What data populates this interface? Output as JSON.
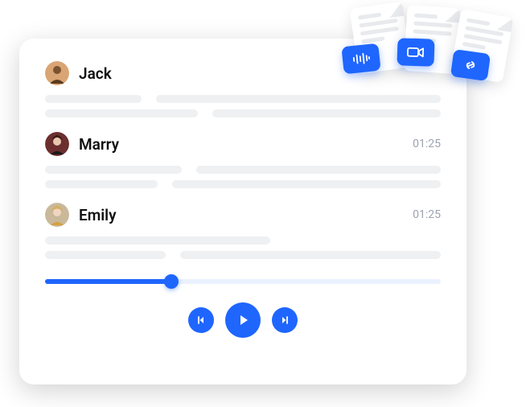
{
  "entries": [
    {
      "name": "Jack",
      "timestamp": "",
      "avatar_bg": "#d9a574"
    },
    {
      "name": "Marry",
      "timestamp": "01:25",
      "avatar_bg": "#6b2f2f"
    },
    {
      "name": "Emily",
      "timestamp": "01:25",
      "avatar_bg": "#c9b89a"
    }
  ],
  "player": {
    "progress_percent": 32
  },
  "colors": {
    "accent": "#1f66ff",
    "placeholder": "#eef0f2",
    "track_bg": "#eaf1fe"
  },
  "badges": [
    "audio-waveform-icon",
    "video-icon",
    "link-icon"
  ]
}
